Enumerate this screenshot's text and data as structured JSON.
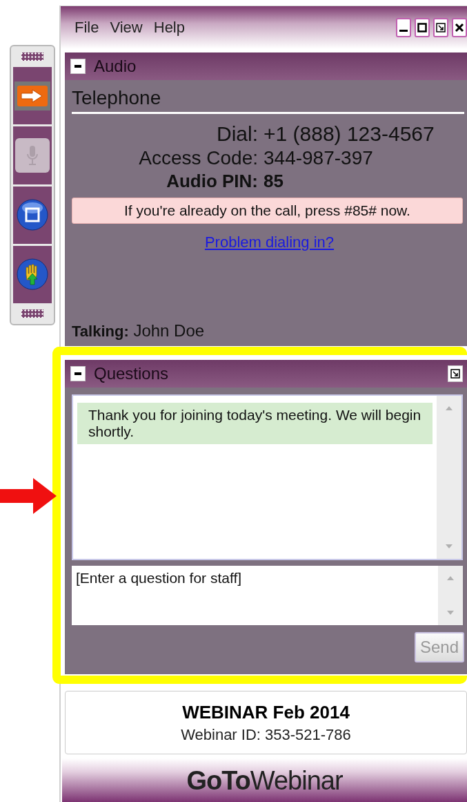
{
  "menu": [
    "File",
    "View",
    "Help"
  ],
  "toolbar": [
    {
      "kind": "arrow",
      "disabled": false
    },
    {
      "kind": "mic",
      "disabled": true
    },
    {
      "kind": "screen",
      "disabled": false
    },
    {
      "kind": "hand",
      "disabled": false
    }
  ],
  "audio": {
    "title": "Audio",
    "section": "Telephone",
    "rows": [
      {
        "label": "Dial:",
        "value": "+1 (888) 123-4567",
        "kind": "plain"
      },
      {
        "label": "Access Code:",
        "value": "344-987-397",
        "kind": "plain"
      },
      {
        "label": "Audio PIN:",
        "value": "85",
        "kind": "bold"
      }
    ],
    "notice": "If you're already on the call, press #85# now.",
    "link": "Problem dialing in?",
    "talking": "**Talking:** John Doe"
  },
  "questions": {
    "title": "Questions",
    "messages": [
      "Thank you for joining today's meeting. We will begin shortly."
    ],
    "input": {
      "placeholder": "[Enter a question for staff]"
    },
    "send": {
      "label": "Send",
      "disabled": true
    }
  },
  "footer": {
    "title": "WEBINAR Feb 2014",
    "webinar_id": "Webinar ID: 353-521-786",
    "logo": "**GoTo**Webinar"
  }
}
